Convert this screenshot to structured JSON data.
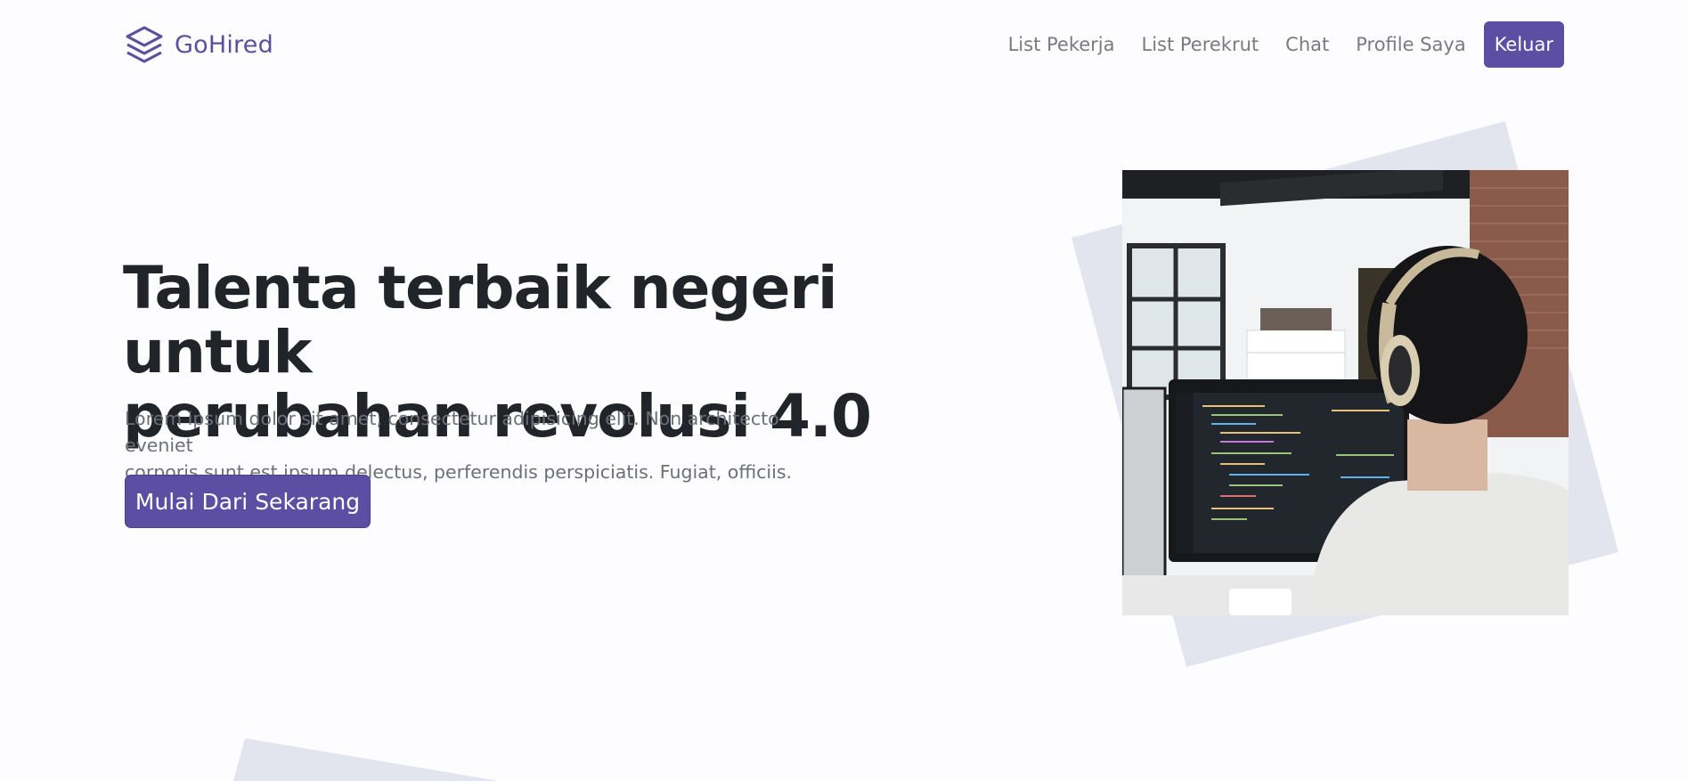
{
  "brand": {
    "name": "GoHired",
    "icon": "layers-icon"
  },
  "nav": {
    "links": [
      "List Pekerja",
      "List Perekrut",
      "Chat",
      "Profile Saya"
    ],
    "logout_label": "Keluar"
  },
  "hero": {
    "title_line1": "Talenta terbaik negeri untuk",
    "title_line2": "perubahan revolusi 4.0",
    "subtitle_line1": "Lorem ipsum dolor sit amet, consectetur adipisicing elit. Non architecto eveniet",
    "subtitle_line2": "corporis sunt est ipsum delectus, perferendis perspiciatis. Fugiat, officiis.",
    "cta_label": "Mulai Dari Sekarang"
  },
  "colors": {
    "accent": "#5c4fa3",
    "deco": "#e2e4ee",
    "muted_text": "#6c6f78",
    "heading": "#212529"
  }
}
